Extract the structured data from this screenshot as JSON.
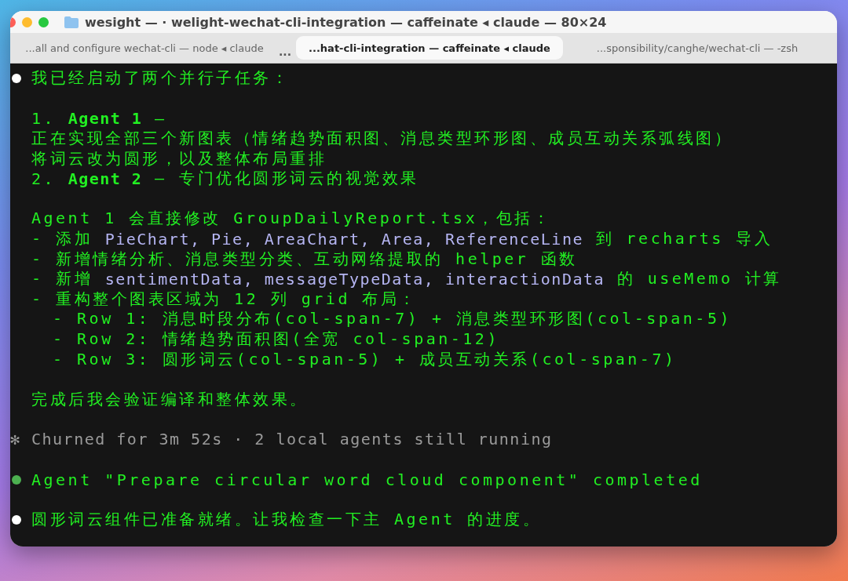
{
  "window": {
    "title": "wesight —  · welight-wechat-cli-integration — caffeinate ◂ claude — 80×24"
  },
  "tabs": [
    {
      "kind": "tab",
      "label": "...all and configure wechat-cli — node ◂ claude",
      "selected": false
    },
    {
      "kind": "overflow",
      "label": "..."
    },
    {
      "kind": "tab",
      "label": "...hat-cli-integration — caffeinate ◂ claude",
      "selected": true
    },
    {
      "kind": "tab",
      "label": "...sponsibility/canghe/wechat-cli — -zsh",
      "selected": false
    }
  ],
  "terminal": {
    "lines": [
      {
        "kind": "line",
        "dot": true,
        "color": "#ffffff",
        "segments": [
          {
            "kind": "text",
            "text": "我已经启动了两个并行子任务："
          }
        ]
      },
      {
        "kind": "blank"
      },
      {
        "kind": "line",
        "segments": [
          {
            "kind": "text",
            "text": "1. "
          },
          {
            "kind": "bold",
            "text": "Agent 1"
          },
          {
            "kind": "text",
            "text": " —"
          }
        ]
      },
      {
        "kind": "line",
        "segments": [
          {
            "kind": "text",
            "text": "正在实现全部三个新图表（情绪趋势面积图、消息类型环形图、成员互动关系弧线图）"
          }
        ]
      },
      {
        "kind": "line",
        "segments": [
          {
            "kind": "text",
            "text": "将词云改为圆形，以及整体布局重排"
          }
        ]
      },
      {
        "kind": "line",
        "segments": [
          {
            "kind": "text",
            "text": "2. "
          },
          {
            "kind": "bold",
            "text": "Agent 2"
          },
          {
            "kind": "text",
            "text": " — 专门优化圆形词云的视觉效果"
          }
        ]
      },
      {
        "kind": "blank"
      },
      {
        "kind": "line",
        "segments": [
          {
            "kind": "text",
            "text": "Agent 1 会直接修改 GroupDailyReport.tsx，包括："
          }
        ]
      },
      {
        "kind": "line",
        "segments": [
          {
            "kind": "text",
            "text": "- 添加 "
          },
          {
            "kind": "code",
            "text": "PieChart, Pie, AreaChart, Area, ReferenceLine"
          },
          {
            "kind": "text",
            "text": " 到 recharts 导入"
          }
        ]
      },
      {
        "kind": "line",
        "segments": [
          {
            "kind": "text",
            "text": "- 新增情绪分析、消息类型分类、互动网络提取的 helper 函数"
          }
        ]
      },
      {
        "kind": "line",
        "segments": [
          {
            "kind": "text",
            "text": "- 新增 "
          },
          {
            "kind": "code",
            "text": "sentimentData, messageTypeData, interactionData"
          },
          {
            "kind": "text",
            "text": " 的 useMemo 计算"
          }
        ]
      },
      {
        "kind": "line",
        "segments": [
          {
            "kind": "text",
            "text": "- 重构整个图表区域为 12 列 grid 布局："
          }
        ]
      },
      {
        "kind": "sub",
        "segments": [
          {
            "kind": "text",
            "text": "- Row 1: 消息时段分布(col-span-7) + 消息类型环形图(col-span-5)"
          }
        ]
      },
      {
        "kind": "sub",
        "segments": [
          {
            "kind": "text",
            "text": "- Row 2: 情绪趋势面积图(全宽 col-span-12)"
          }
        ]
      },
      {
        "kind": "sub",
        "segments": [
          {
            "kind": "text",
            "text": "- Row 3: 圆形词云(col-span-5) + 成员互动关系(col-span-7)"
          }
        ]
      },
      {
        "kind": "blank"
      },
      {
        "kind": "line",
        "segments": [
          {
            "kind": "text",
            "text": "完成后我会验证编译和整体效果。"
          }
        ]
      },
      {
        "kind": "blank"
      },
      {
        "kind": "line",
        "prefix": "✻",
        "segments": [
          {
            "kind": "muted",
            "text": "Churned for 3m 52s · 2 local agents still running"
          }
        ]
      },
      {
        "kind": "blank"
      },
      {
        "kind": "line",
        "dot": true,
        "color": "#4caf50",
        "segments": [
          {
            "kind": "text",
            "text": "Agent \"Prepare circular word cloud component\" completed"
          }
        ]
      },
      {
        "kind": "blank"
      },
      {
        "kind": "line",
        "dot": true,
        "color": "#ffffff",
        "segments": [
          {
            "kind": "text",
            "text": "圆形词云组件已准备就绪。让我检查一下主 Agent 的进度。"
          }
        ]
      }
    ]
  }
}
